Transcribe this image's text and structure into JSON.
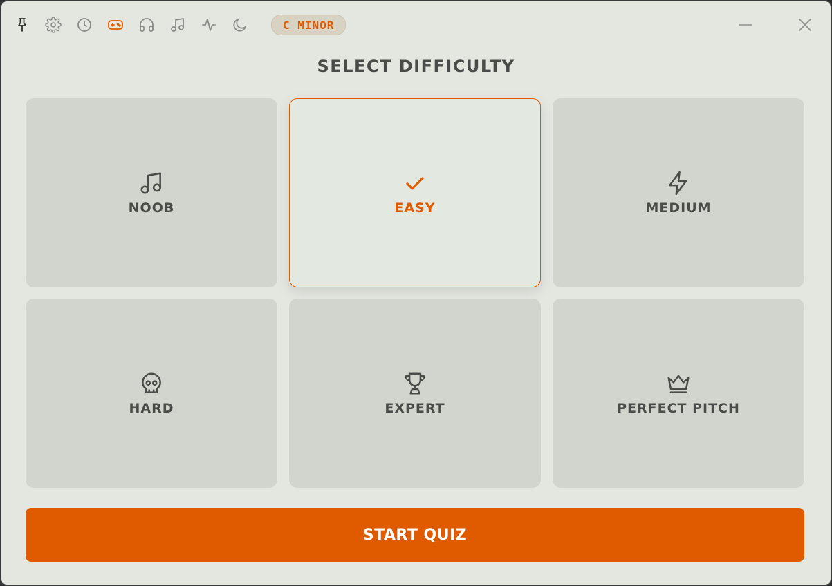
{
  "toolbar": {
    "icons": [
      "pin-icon",
      "gear-icon",
      "clock-icon",
      "gamepad-icon",
      "headphones-icon",
      "music-note-icon",
      "activity-icon",
      "moon-icon"
    ],
    "active_icon": "gamepad-icon",
    "key_badge": "C MINOR"
  },
  "window_controls": {
    "minimize": "minimize-icon",
    "close": "close-icon"
  },
  "main": {
    "heading": "SELECT DIFFICULTY",
    "difficulties": [
      {
        "label": "NOOB",
        "icon": "music-note-icon",
        "selected": false
      },
      {
        "label": "EASY",
        "icon": "checkmark-icon",
        "selected": true
      },
      {
        "label": "MEDIUM",
        "icon": "lightning-icon",
        "selected": false
      },
      {
        "label": "HARD",
        "icon": "skull-icon",
        "selected": false
      },
      {
        "label": "EXPERT",
        "icon": "trophy-icon",
        "selected": false
      },
      {
        "label": "PERFECT PITCH",
        "icon": "crown-icon",
        "selected": false
      }
    ],
    "start_label": "START QUIZ"
  },
  "colors": {
    "accent": "#e05a00",
    "background": "#e3e7e0",
    "card": "#d1d5ce",
    "text": "#4b4c49"
  }
}
